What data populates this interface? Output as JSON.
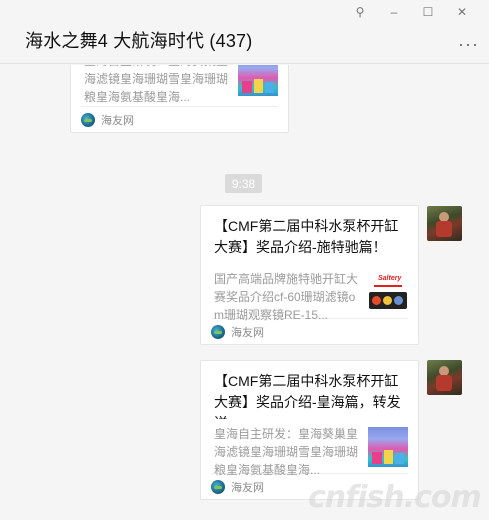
{
  "window": {
    "title": "海水之舞4 大航海时代 (437)",
    "controls": {
      "pin": "⚲",
      "minimize": "–",
      "maximize": "☐",
      "close": "✕"
    },
    "more": "···"
  },
  "messages": [
    {
      "desc": "皇海自主研发：皇海葵巢皇海滤镜皇海珊瑚雪皇海珊瑚粮皇海氨基酸皇海...",
      "source": "海友网"
    },
    {
      "time": "9:38"
    },
    {
      "title": "【CMF第二届中科水泵杯开缸大赛】奖品介绍-施特驰篇！",
      "desc": "国产高端品牌施特驰开缸大赛奖品介绍cf-60珊瑚滤镜om珊瑚观察镜RE-15...",
      "thumb_brand": "Saltery",
      "source": "海友网"
    },
    {
      "title": "【CMF第二届中科水泵杯开缸大赛】奖品介绍-皇海篇，转发送...",
      "desc": "皇海自主研发：皇海葵巢皇海滤镜皇海珊瑚雪皇海珊瑚粮皇海氨基酸皇海...",
      "source": "海友网"
    }
  ],
  "watermark": "cnfish.com"
}
